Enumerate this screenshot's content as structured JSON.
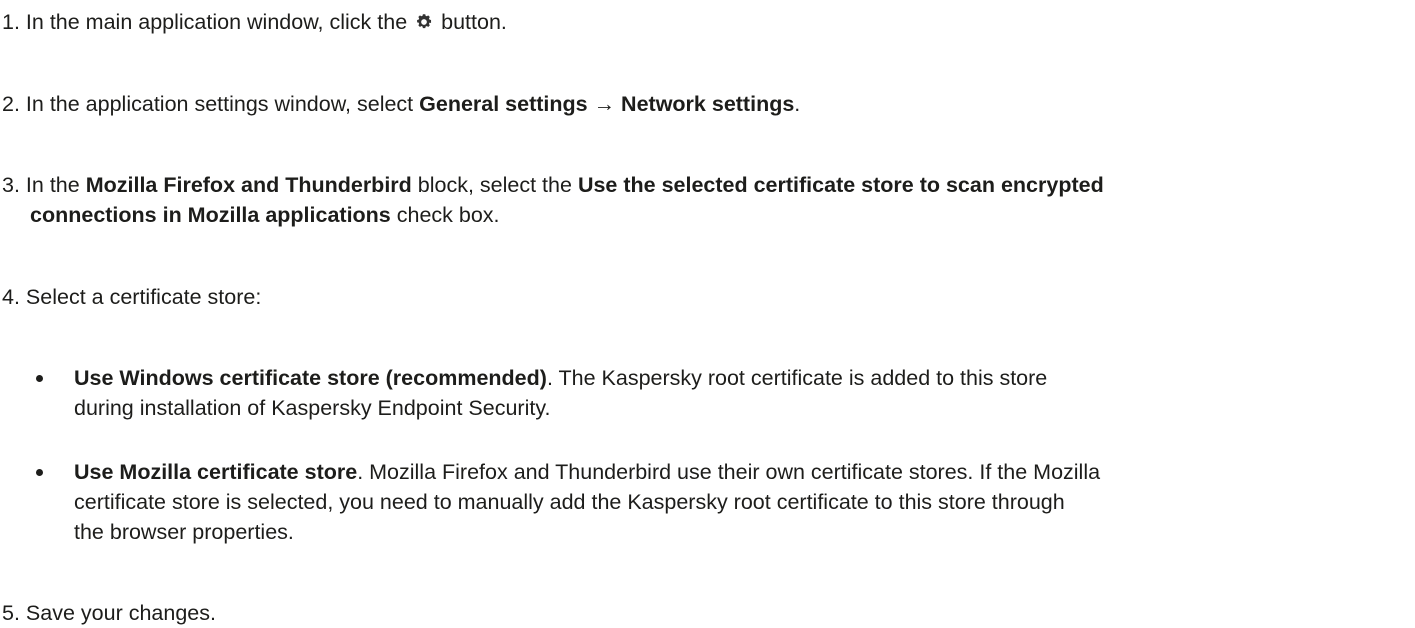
{
  "steps": [
    {
      "num": "1.",
      "pre": "In the main application window, click the",
      "icon": "gear-icon",
      "post": "button."
    },
    {
      "num": "2.",
      "pre": "In the application settings window, select",
      "bold1": "General settings → Network settings",
      "post": "."
    },
    {
      "num": "3.",
      "pre": "In the",
      "bold1": "Mozilla Firefox and Thunderbird",
      "mid": "block, select the",
      "bold2": "Use the selected certificate store to scan encrypted",
      "bold3": "connections in Mozilla applications",
      "post": "check box."
    },
    {
      "num": "4.",
      "text": "Select a certificate store:"
    },
    {
      "num": "5.",
      "text": "Save your changes."
    }
  ],
  "options": [
    {
      "bold": "Use Windows certificate store (recommended)",
      "line1": ". The Kaspersky root certificate is added to this store",
      "line2": "during installation of Kaspersky Endpoint Security."
    },
    {
      "bold": "Use Mozilla certificate store",
      "line1": ". Mozilla Firefox and Thunderbird use their own certificate stores. If the Mozilla",
      "line2": "certificate store is selected, you need to manually add the Kaspersky root certificate to this store through",
      "line3": "the browser properties."
    }
  ]
}
